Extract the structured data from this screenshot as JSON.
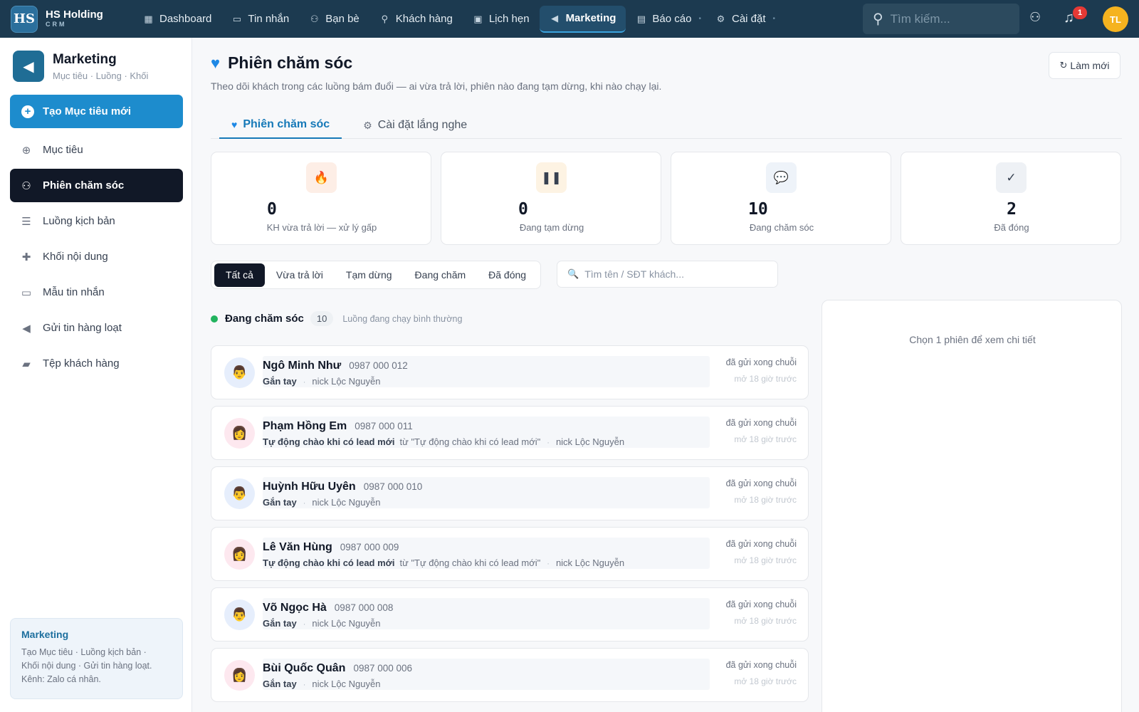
{
  "app": {
    "logo": "HS",
    "name": "HS Holding",
    "sub": "CRM"
  },
  "nav": [
    {
      "label": "Dashboard",
      "icon": "dashboard-icon",
      "active": false
    },
    {
      "label": "Tin nhắn",
      "icon": "message-icon",
      "active": false
    },
    {
      "label": "Bạn bè",
      "icon": "friends-icon",
      "active": false
    },
    {
      "label": "Khách hàng",
      "icon": "customer-icon",
      "active": false
    },
    {
      "label": "Lịch hẹn",
      "icon": "calendar-icon",
      "active": false
    },
    {
      "label": "Marketing",
      "icon": "megaphone-icon",
      "active": true
    },
    {
      "label": "Báo cáo",
      "icon": "report-icon",
      "active": false
    },
    {
      "label": "Cài đặt",
      "icon": "gear-icon",
      "active": false
    }
  ],
  "topbar": {
    "search_placeholder": "Tìm kiếm...",
    "notif_count": "1",
    "avatar_initials": "TL"
  },
  "sidebar": {
    "title": "Marketing",
    "subtitle": "Mục tiêu · Luồng · Khối",
    "create_label": "Tạo Mục tiêu mới",
    "items": [
      {
        "label": "Mục tiêu",
        "icon": "target-icon",
        "active": false
      },
      {
        "label": "Phiên chăm sóc",
        "icon": "users-care-icon",
        "active": true
      },
      {
        "label": "Luồng kịch bản",
        "icon": "list-icon",
        "active": false
      },
      {
        "label": "Khối nội dung",
        "icon": "puzzle-icon",
        "active": false
      },
      {
        "label": "Mẫu tin nhắn",
        "icon": "message-template-icon",
        "active": false
      },
      {
        "label": "Gửi tin hàng loạt",
        "icon": "broadcast-icon",
        "active": false
      },
      {
        "label": "Tệp khách hàng",
        "icon": "folder-user-icon",
        "active": false
      }
    ],
    "footer_title": "Marketing",
    "footer_text_1": "Tạo Mục tiêu · Luồng kịch bản ·",
    "footer_text_2": "Khối nội dung · Gửi tin hàng loạt.",
    "footer_text_3": "Kênh: Zalo cá nhân."
  },
  "page": {
    "title": "Phiên chăm sóc",
    "description": "Theo dõi khách trong các luồng bám đuổi — ai vừa trả lời, phiên nào đang tạm dừng, khi nào chạy lại.",
    "refresh_label": "Làm mới"
  },
  "tabs": [
    {
      "label": "Phiên chăm sóc",
      "icon": "heart-icon",
      "active": true
    },
    {
      "label": "Cài đặt lắng nghe",
      "icon": "gear-icon",
      "active": false
    }
  ],
  "stats": [
    {
      "value": "0",
      "label": "KH vừa trả lời — xử lý gấp",
      "icon": "fire-icon",
      "bg": "#fdeee6"
    },
    {
      "value": "0",
      "label": "Đang tạm dừng",
      "icon": "pause-icon",
      "bg": "#fdf3e3"
    },
    {
      "value": "10",
      "label": "Đang chăm sóc",
      "icon": "chat-bubble-icon",
      "bg": "#eef3f9"
    },
    {
      "value": "2",
      "label": "Đã đóng",
      "icon": "check-icon",
      "bg": "#eef1f5"
    }
  ],
  "filters": [
    {
      "label": "Tất cả",
      "active": true
    },
    {
      "label": "Vừa trả lời",
      "active": false
    },
    {
      "label": "Tạm dừng",
      "active": false
    },
    {
      "label": "Đang chăm",
      "active": false
    },
    {
      "label": "Đã đóng",
      "active": false
    }
  ],
  "list_search_placeholder": "Tìm tên / SĐT khách...",
  "group": {
    "title": "Đang chăm sóc",
    "count": "10",
    "note": "Luồng đang chạy bình thường"
  },
  "sessions": [
    {
      "name": "Ngô Minh Như",
      "phone": "0987 000 012",
      "source": "Gắn tay",
      "from": "",
      "nick": "nick Lộc Nguyễn",
      "status": "đã gửi xong chuỗi",
      "time": "mở 18 giờ trước",
      "gender": "m"
    },
    {
      "name": "Phạm Hồng Em",
      "phone": "0987 000 011",
      "source": "Tự động chào khi có lead mới",
      "from": "từ \"Tự động chào khi có lead mới\"",
      "nick": "nick Lộc Nguyễn",
      "status": "đã gửi xong chuỗi",
      "time": "mở 18 giờ trước",
      "gender": "f"
    },
    {
      "name": "Huỳnh Hữu Uyên",
      "phone": "0987 000 010",
      "source": "Gắn tay",
      "from": "",
      "nick": "nick Lộc Nguyễn",
      "status": "đã gửi xong chuỗi",
      "time": "mở 18 giờ trước",
      "gender": "m"
    },
    {
      "name": "Lê Văn Hùng",
      "phone": "0987 000 009",
      "source": "Tự động chào khi có lead mới",
      "from": "từ \"Tự động chào khi có lead mới\"",
      "nick": "nick Lộc Nguyễn",
      "status": "đã gửi xong chuỗi",
      "time": "mở 18 giờ trước",
      "gender": "f"
    },
    {
      "name": "Võ Ngọc Hà",
      "phone": "0987 000 008",
      "source": "Gắn tay",
      "from": "",
      "nick": "nick Lộc Nguyễn",
      "status": "đã gửi xong chuỗi",
      "time": "mở 18 giờ trước",
      "gender": "m"
    },
    {
      "name": "Bùi Quốc Quân",
      "phone": "0987 000 006",
      "source": "Gắn tay",
      "from": "",
      "nick": "nick Lộc Nguyễn",
      "status": "đã gửi xong chuỗi",
      "time": "mở 18 giờ trước",
      "gender": "f"
    }
  ],
  "detail": {
    "empty_text": "Chọn 1 phiên để xem chi tiết"
  }
}
